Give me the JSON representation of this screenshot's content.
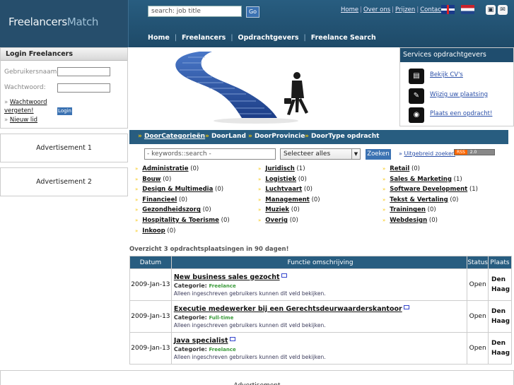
{
  "header": {
    "logo_part1": "Freelancers",
    "logo_part2": "Match",
    "search_placeholder": "search: job title",
    "search_button": "Go",
    "top_links": [
      "Home",
      "Over ons",
      "Prijzen",
      "Contact"
    ],
    "nav": [
      "Home",
      "Freelancers",
      "Opdrachtgevers",
      "Freelance Search"
    ]
  },
  "login": {
    "title": "Login Freelancers",
    "username_label": "Gebruikersnaam:",
    "password_label": "Wachtwoord:",
    "forgot_line1": "Wachtwoord",
    "forgot_line2": "vergeten!",
    "login_button": "Login",
    "new_member": "Nieuw lid"
  },
  "ads": {
    "ad1": "Advertisement 1",
    "ad2": "Advertisement 2",
    "bottom": "Advertisement"
  },
  "services": {
    "title": "Services opdrachtgevers",
    "items": [
      {
        "label": "Bekijk CV's",
        "icon": "cv-card-icon"
      },
      {
        "label": "Wijzig uw plaatsing",
        "icon": "pencil-icon"
      },
      {
        "label": "Plaats een opdracht!",
        "icon": "signal-icon"
      }
    ]
  },
  "categories": {
    "tabs": [
      "DoorCategorieën",
      "DoorLand",
      "DoorProvincie",
      "DoorType opdracht"
    ],
    "keyword_placeholder": "- keywords::search -",
    "select_value": "Selecteer alles",
    "search_button": "Zoeken",
    "advanced_link": "Uitgebreid zoeken",
    "rss_label": "RSS",
    "rss_version": "2.0",
    "col1": [
      {
        "name": "Administratie",
        "count": "(0)"
      },
      {
        "name": "Bouw",
        "count": "(0)"
      },
      {
        "name": "Design & Multimedia",
        "count": "(0)"
      },
      {
        "name": "Financieel",
        "count": "(0)"
      },
      {
        "name": "Gezondheidszorg",
        "count": "(0)"
      },
      {
        "name": "Hospitality & Toerisme",
        "count": "(0)"
      },
      {
        "name": "Inkoop",
        "count": "(0)"
      }
    ],
    "col2": [
      {
        "name": "Juridisch",
        "count": "(1)"
      },
      {
        "name": "Logistiek",
        "count": "(0)"
      },
      {
        "name": "Luchtvaart",
        "count": "(0)"
      },
      {
        "name": "Management",
        "count": "(0)"
      },
      {
        "name": "Muziek",
        "count": "(0)"
      },
      {
        "name": "Overig",
        "count": "(0)"
      }
    ],
    "col3": [
      {
        "name": "Retail",
        "count": "(0)"
      },
      {
        "name": "Sales & Marketing",
        "count": "(1)"
      },
      {
        "name": "Software Development",
        "count": "(1)"
      },
      {
        "name": "Tekst & Vertaling",
        "count": "(0)"
      },
      {
        "name": "Trainingen",
        "count": "(0)"
      },
      {
        "name": "Webdesign",
        "count": "(0)"
      }
    ]
  },
  "overview": {
    "title": "Overzicht 3 opdrachtsplaatsingen in 90 dagen!",
    "headers": [
      "Datum",
      "Functie omschrijving",
      "Status",
      "Plaats"
    ],
    "rows": [
      {
        "date": "2009-Jan-13",
        "title": "New business sales gezocht",
        "cat_label": "Categorie:",
        "cat_value": "Freelance",
        "note": "Alleen ingeschreven gebruikers kunnen dit veld bekijken.",
        "status": "Open",
        "place1": "Den",
        "place2": "Haag"
      },
      {
        "date": "2009-Jan-13",
        "title": "Executie medewerker bij een Gerechtsdeurwaarderskantoor",
        "cat_label": "Categorie:",
        "cat_value": "Full-time",
        "note": "Alleen ingeschreven gebruikers kunnen dit veld bekijken.",
        "status": "Open",
        "place1": "Den",
        "place2": "Haag"
      },
      {
        "date": "2009-Jan-13",
        "title": "Java specialist",
        "cat_label": "Categorie:",
        "cat_value": "Freelance",
        "note": "Alleen ingeschreven gebruikers kunnen dit veld bekijken.",
        "status": "Open",
        "place1": "Den",
        "place2": "Haag"
      }
    ]
  },
  "colors": {
    "header_blue": "#1f4d6e",
    "accent_yellow": "#f6c400",
    "button_blue": "#3b72b2"
  }
}
